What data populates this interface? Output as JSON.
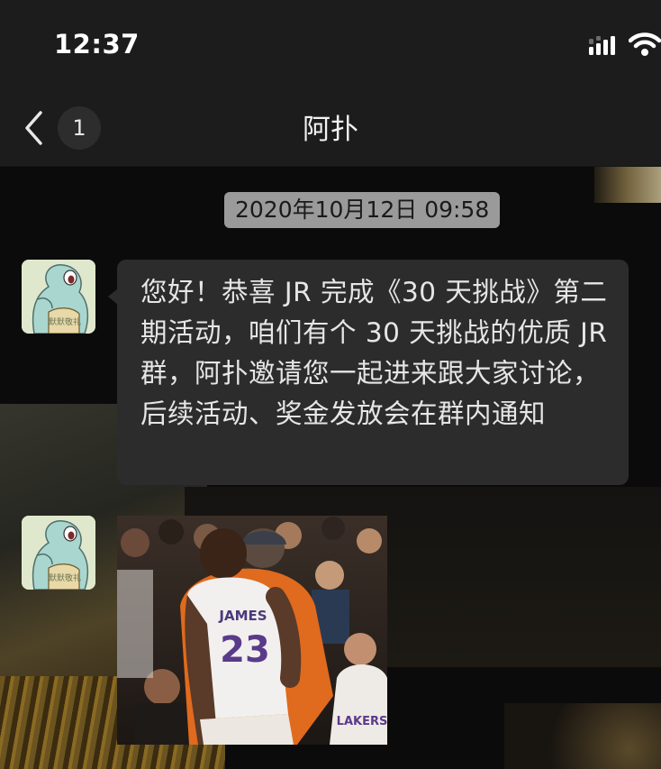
{
  "status_bar": {
    "time": "12:37"
  },
  "nav": {
    "back_count": "1",
    "title": "阿扑"
  },
  "chat": {
    "timestamp": "2020年10月12日 09:58",
    "messages": [
      {
        "type": "text",
        "text": "您好！恭喜 JR 完成《30 天挑战》第二期活动，咱们有个 30 天挑战的优质 JR 群，阿扑邀请您一起进来跟大家讨论，后续活动、奖金发放会在群内通知"
      },
      {
        "type": "image",
        "jersey_name": "JAMES",
        "jersey_number": "23",
        "shirt_text": "LAKERS"
      }
    ],
    "avatar_caption": "默默敬礼"
  },
  "colors": {
    "background": "#0b0b0b",
    "bar": "#1c1c1c",
    "bubble": "#2c2c2c",
    "timestamp_bg": "#9a9a9a"
  },
  "icons": [
    "back-chevron-icon",
    "signal-icon",
    "wifi-icon"
  ]
}
